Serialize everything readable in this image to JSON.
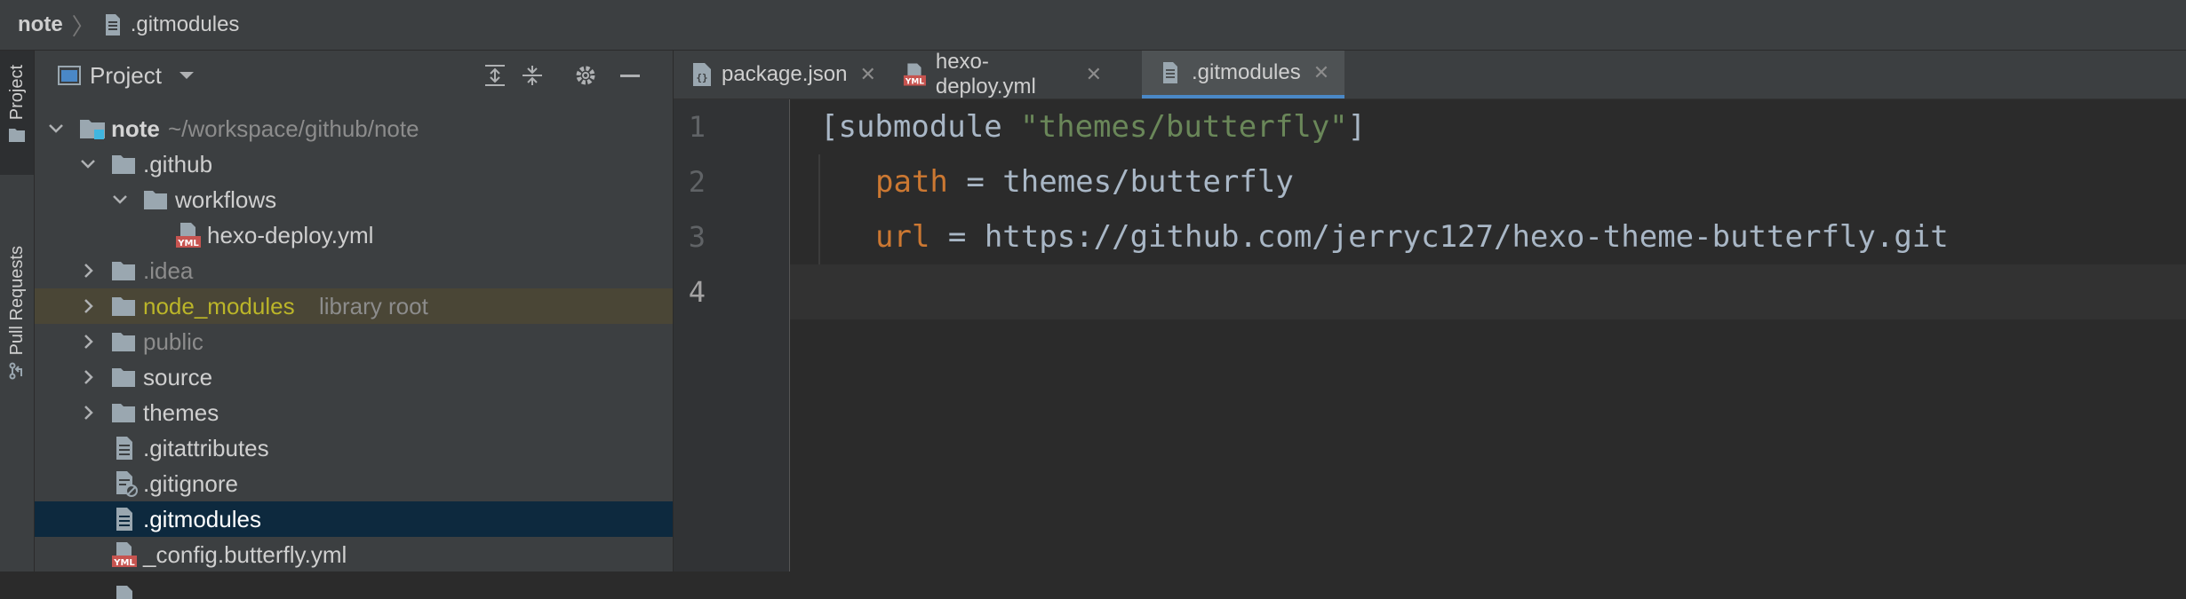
{
  "colors": {
    "background": "#2b2b2b",
    "panel": "#3c3f41",
    "selection": "#0d293e",
    "library_highlight": "#4a4636",
    "accent_tab": "#4a88c7",
    "string": "#6a8759",
    "key": "#cc7832",
    "library_text": "#bbb529"
  },
  "navbar": {
    "root": "note",
    "file": ".gitmodules"
  },
  "left_strip": {
    "project_tab": "Project",
    "pull_requests_tab": "Pull Requests"
  },
  "project_panel": {
    "title": "Project",
    "tree": [
      {
        "label": "note",
        "path": "~/workspace/github/note",
        "icon": "module-folder-icon",
        "expanded": true
      },
      {
        "label": ".github",
        "icon": "folder-icon",
        "expanded": true
      },
      {
        "label": "workflows",
        "icon": "folder-icon",
        "expanded": true
      },
      {
        "label": "hexo-deploy.yml",
        "icon": "yml-file-icon"
      },
      {
        "label": ".idea",
        "icon": "folder-icon",
        "expanded": false
      },
      {
        "label": "node_modules",
        "suffix": "library root",
        "icon": "folder-icon",
        "expanded": false
      },
      {
        "label": "public",
        "icon": "folder-icon",
        "expanded": false
      },
      {
        "label": "source",
        "icon": "folder-icon",
        "expanded": false
      },
      {
        "label": "themes",
        "icon": "folder-icon",
        "expanded": false
      },
      {
        "label": ".gitattributes",
        "icon": "text-file-icon"
      },
      {
        "label": ".gitignore",
        "icon": "ignore-file-icon"
      },
      {
        "label": ".gitmodules",
        "icon": "text-file-icon",
        "selected": true
      },
      {
        "label": "_config.butterfly.yml",
        "icon": "yml-file-icon"
      }
    ]
  },
  "editor": {
    "tabs": [
      {
        "label": "package.json",
        "icon": "json-file-icon"
      },
      {
        "label": "hexo-deploy.yml",
        "icon": "yml-file-icon"
      },
      {
        "label": ".gitmodules",
        "icon": "text-file-icon",
        "active": true
      }
    ],
    "line_numbers": [
      "1",
      "2",
      "3",
      "4"
    ],
    "lines": {
      "l1_open": "[submodule ",
      "l1_str": "\"themes/butterfly\"",
      "l1_close": "]",
      "l2_key": "path",
      "l2_rest": " = themes/butterfly",
      "l3_key": "url",
      "l3_rest": " = https://github.com/jerryc127/hexo-theme-butterfly.git"
    }
  }
}
